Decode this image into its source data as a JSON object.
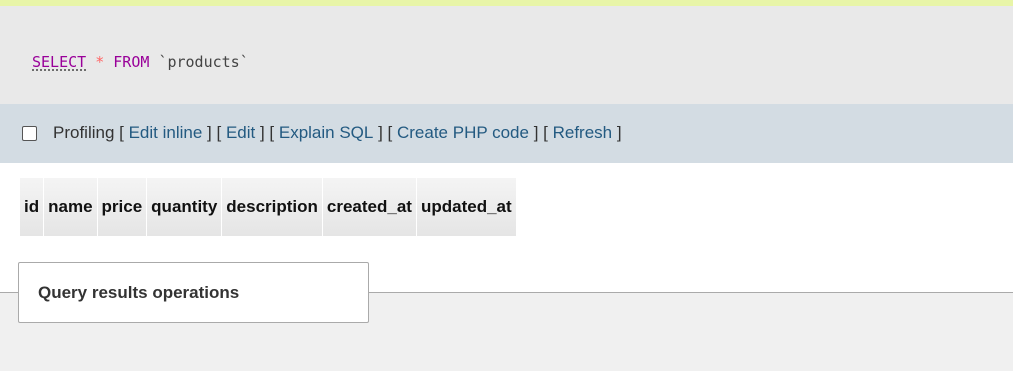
{
  "sql": {
    "select_kw": "SELECT",
    "star": "*",
    "from_kw": "FROM",
    "table": "`products`"
  },
  "ops": {
    "profiling_label": "Profiling",
    "links": [
      {
        "label": "Edit inline"
      },
      {
        "label": "Edit"
      },
      {
        "label": "Explain SQL"
      },
      {
        "label": "Create PHP code"
      },
      {
        "label": "Refresh"
      }
    ]
  },
  "results": {
    "columns": [
      "id",
      "name",
      "price",
      "quantity",
      "description",
      "created_at",
      "updated_at"
    ]
  },
  "query_results_ops": {
    "legend": "Query results operations"
  },
  "colors": {
    "keyword": "#990099",
    "operator": "#ff6666",
    "link": "#235a81",
    "ops_bar_bg": "#d3dce3",
    "sql_box_bg": "#e9e9e9",
    "top_strip": "#e8f5a8"
  }
}
